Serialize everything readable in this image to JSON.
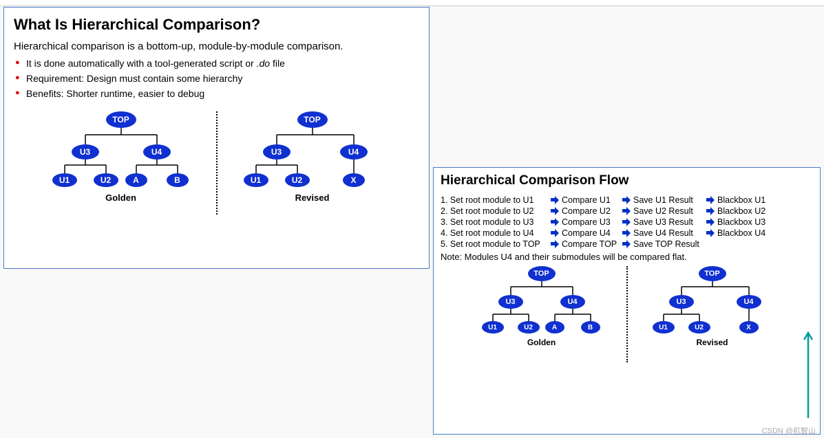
{
  "slide1": {
    "title": "What Is Hierarchical Comparison?",
    "description": "Hierarchical comparison is a bottom-up, module-by-module comparison.",
    "bullets": [
      {
        "pre": "It is done automatically with a tool-generated script or ",
        "ital": ".do",
        "post": " file"
      },
      {
        "text": "Requirement: Design must contain some hierarchy"
      },
      {
        "text": "Benefits: Shorter runtime, easier to debug"
      }
    ],
    "golden_label": "Golden",
    "revised_label": "Revised",
    "golden_tree": {
      "top": "TOP",
      "mid": [
        "U3",
        "U4"
      ],
      "leaves": [
        "U1",
        "U2",
        "A",
        "B"
      ]
    },
    "revised_tree": {
      "top": "TOP",
      "mid": [
        "U3",
        "U4"
      ],
      "leaves": [
        "U1",
        "U2",
        "X"
      ]
    }
  },
  "slide2": {
    "title": "Hierarchical Comparison Flow",
    "steps": [
      {
        "set": "1. Set root module to U1",
        "cmp": "Compare U1",
        "save": "Save U1 Result",
        "bb": "Blackbox U1"
      },
      {
        "set": "2. Set root module to U2",
        "cmp": "Compare U2",
        "save": "Save U2 Result",
        "bb": "Blackbox U2"
      },
      {
        "set": "3. Set root module to U3",
        "cmp": "Compare U3",
        "save": "Save U3 Result",
        "bb": "Blackbox U3"
      },
      {
        "set": "4. Set root module to U4",
        "cmp": "Compare U4",
        "save": "Save U4 Result",
        "bb": "Blackbox U4"
      },
      {
        "set": "5. Set root module to TOP",
        "cmp": "Compare TOP",
        "save": "Save TOP Result",
        "bb": ""
      }
    ],
    "note": "Note: Modules U4 and their submodules will be compared flat.",
    "golden_label": "Golden",
    "revised_label": "Revised",
    "golden_tree": {
      "top": "TOP",
      "mid": [
        "U3",
        "U4"
      ],
      "leaves": [
        "U1",
        "U2",
        "A",
        "B"
      ]
    },
    "revised_tree": {
      "top": "TOP",
      "mid": [
        "U3",
        "U4"
      ],
      "leaves": [
        "U1",
        "U2",
        "X"
      ]
    }
  },
  "watermark": "CSDN @机智山"
}
